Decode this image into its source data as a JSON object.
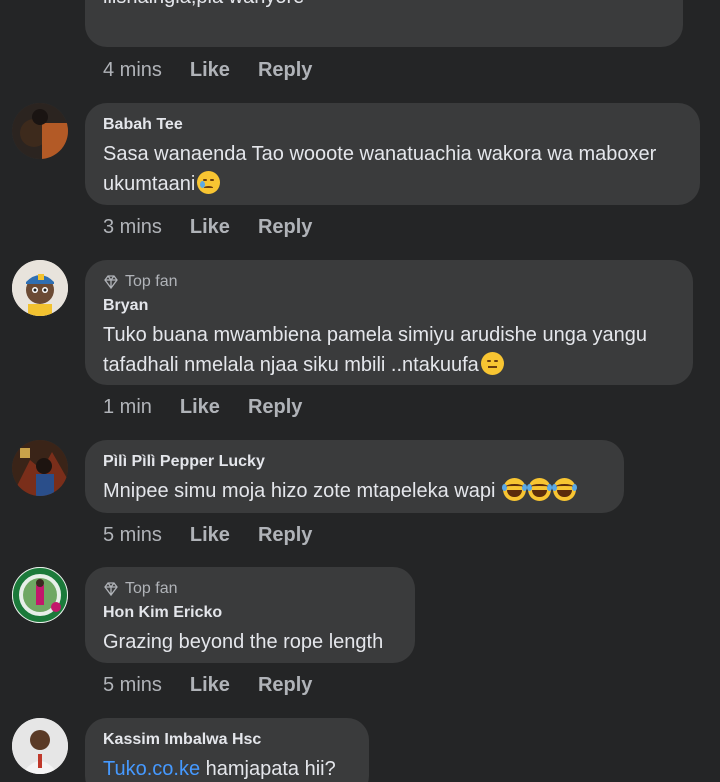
{
  "top_partial": {
    "text_fragment": "lilshaingia,pia wanyore",
    "time": "4 mins",
    "like": "Like",
    "reply": "Reply"
  },
  "comments": [
    {
      "author": "Babah Tee",
      "top_fan": "",
      "text_line1": "Sasa wanaenda Tao wooote wanatuachia wakora wa maboxer",
      "text_line2": "ukumtaani",
      "emoji": [
        "sad-tear"
      ],
      "time": "3 mins",
      "like": "Like",
      "reply": "Reply",
      "avatar_icon": "profile-photo"
    },
    {
      "author": "Bryan",
      "top_fan": "Top fan",
      "text_line1": "Tuko buana mwambiena pamela simiyu arudishe unga yangu",
      "text_line2": "tafadhali nmelala njaa siku mbili ..ntakuufa",
      "emoji": [
        "unamused"
      ],
      "time": "1 min",
      "like": "Like",
      "reply": "Reply",
      "avatar_icon": "cartoon-avatar"
    },
    {
      "author": "Pìlì Pìlì Pepper Lucky",
      "top_fan": "",
      "text_line1": "Mnipee simu moja hizo zote mtapeleka wapi",
      "emoji": [
        "laughing-tears",
        "laughing-tears",
        "laughing-tears"
      ],
      "time": "5 mins",
      "like": "Like",
      "reply": "Reply",
      "avatar_icon": "profile-photo"
    },
    {
      "author": "Hon Kim Ericko",
      "top_fan": "Top fan",
      "text_line1": "Grazing beyond the rope length",
      "time": "5 mins",
      "like": "Like",
      "reply": "Reply",
      "avatar_icon": "profile-photo-frame"
    },
    {
      "author": "Kassim Imbalwa Hsc",
      "top_fan": "",
      "link_text": "Tuko.co.ke",
      "text_after_link": " hamjapata hii?",
      "avatar_icon": "profile-photo"
    }
  ],
  "colors": {
    "background": "#242526",
    "bubble": "#3a3b3c",
    "text": "#e4e6eb",
    "secondary": "#b0b3b8",
    "link": "#4599ff"
  }
}
